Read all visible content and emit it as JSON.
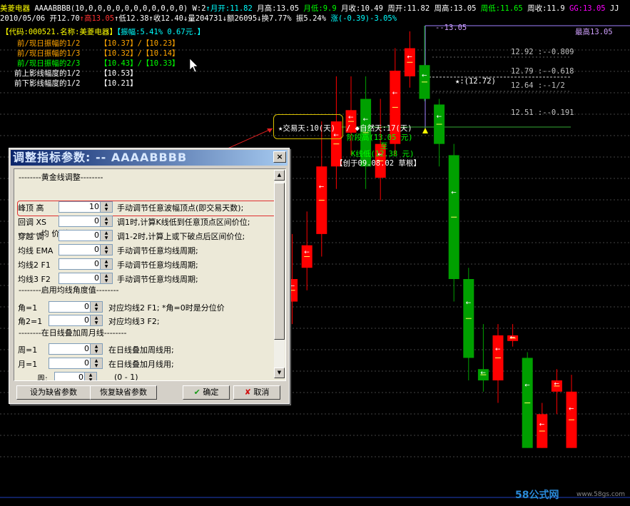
{
  "header": {
    "line1": [
      {
        "t": "美菱电器",
        "c": "#ffff00"
      },
      {
        "t": "  AAAABBBB(10,0,0,0,0,0,0,0,0,0,0,0)  W:2",
        "c": "#ffffff"
      },
      {
        "t": "↑月开:11.82",
        "c": "#00ffff"
      },
      {
        "t": "  月高:13.05",
        "c": "#ffffff"
      },
      {
        "t": "  月低:9.9",
        "c": "#00ff00"
      },
      {
        "t": "  月收:10.49",
        "c": "#ffffff"
      },
      {
        "t": "  周开:11.82",
        "c": "#ffffff"
      },
      {
        "t": "  周高:13.05",
        "c": "#ffffff"
      },
      {
        "t": "  周低:11.65",
        "c": "#00ff00"
      },
      {
        "t": "  周收:11.9",
        "c": "#ffffff"
      },
      {
        "t": "  GG:13.05",
        "c": "#ff00ff"
      },
      {
        "t": "  JJ",
        "c": "#ffffff"
      }
    ],
    "line2": [
      {
        "t": "2010/05/06",
        "c": "#ffffff"
      },
      {
        "t": "  开12.70",
        "c": "#ffffff"
      },
      {
        "t": "↑高13.05",
        "c": "#ff3030"
      },
      {
        "t": "↑低12.38",
        "c": "#ffffff"
      },
      {
        "t": "↑收12.40",
        "c": "#ffffff"
      },
      {
        "t": "↓量204731",
        "c": "#ffffff"
      },
      {
        "t": "↓额26095",
        "c": "#ffffff"
      },
      {
        "t": "↓换7.77%",
        "c": "#ffffff"
      },
      {
        "t": "  振5.24%",
        "c": "#ffffff"
      },
      {
        "t": "  涨(-0.39)-3.05%",
        "c": "#00ffff"
      }
    ],
    "line3": [
      {
        "t": "【代码:000521.名称:美菱电器】",
        "c": "#ffff00"
      },
      {
        "t": "【振幅:5.41% 0.67元.】",
        "c": "#00ffff"
      }
    ]
  },
  "info_rows": [
    {
      "label": "前/现日振幅的1/2",
      "vals": "【10.37】/【10.23】",
      "c": "#ffa500"
    },
    {
      "label": "前/现日振幅的1/3",
      "vals": "【10.32】/【10.14】",
      "c": "#ffa500"
    },
    {
      "label": "前/现日振幅的2/3",
      "vals": "【10.43】/【10.33】",
      "c": "#00ff00"
    },
    {
      "label": "前上影线幅度的1/2",
      "vals": "【10.53】",
      "c": "#ffffff"
    },
    {
      "label": "前下影线幅度的1/2",
      "vals": "【10.21】",
      "c": "#ffffff"
    }
  ],
  "levels": [
    {
      "text": "--13.05",
      "c": "#d0a0ff"
    },
    {
      "text": "最高13.05",
      "c": "#d0a0ff"
    },
    {
      "text": "12.92  :--0.809",
      "c": "#c0c0c0"
    },
    {
      "text": "12.79  :--0.618",
      "c": "#c0c0c0"
    },
    {
      "text": "12.64  :--1/2",
      "c": "#c0c0c0"
    },
    {
      "text": "12.51  :--0.191",
      "c": "#c0c0c0"
    }
  ],
  "annotations": {
    "star_value": "★:(12.72)",
    "trade_days": "★交易天:10(天)",
    "natural_days": "/ ◆自然天:17(天)",
    "stage_high": "阶段高(13.05 元)",
    "to": "至",
    "k_low": "K线低(12.38 元)",
    "created": "【创于09.08.02 草根】"
  },
  "candles": [
    {
      "o": 10.9,
      "c": 10.3,
      "h": 11.0,
      "l": 10.1,
      "col": "#ff0000"
    },
    {
      "o": 10.6,
      "c": 10.8,
      "h": 11.2,
      "l": 10.4,
      "col": "#ff0000"
    },
    {
      "o": 10.9,
      "c": 11.1,
      "h": 11.4,
      "l": 10.7,
      "col": "#ff0000"
    },
    {
      "o": 11.2,
      "c": 11.8,
      "h": 12.2,
      "l": 11.0,
      "col": "#ff0000"
    },
    {
      "o": 11.8,
      "c": 12.2,
      "h": 12.6,
      "l": 11.6,
      "col": "#ff0000"
    },
    {
      "o": 12.1,
      "c": 12.3,
      "h": 12.6,
      "l": 11.9,
      "col": "#ff0000"
    },
    {
      "o": 12.4,
      "c": 11.8,
      "h": 12.6,
      "l": 11.6,
      "col": "#00a000"
    },
    {
      "o": 11.7,
      "c": 12.0,
      "h": 12.4,
      "l": 11.5,
      "col": "#ff0000"
    },
    {
      "o": 12.0,
      "c": 12.65,
      "h": 12.85,
      "l": 11.9,
      "col": "#ff0000"
    },
    {
      "o": 12.6,
      "c": 12.85,
      "h": 13.0,
      "l": 12.5,
      "col": "#ff0000"
    },
    {
      "o": 12.7,
      "c": 12.4,
      "h": 13.05,
      "l": 12.38,
      "col": "#00a000"
    },
    {
      "o": 12.35,
      "c": 12.0,
      "h": 12.4,
      "l": 11.8,
      "col": "#00a000"
    },
    {
      "o": 11.9,
      "c": 10.8,
      "h": 12.0,
      "l": 10.6,
      "col": "#00a000"
    },
    {
      "o": 10.8,
      "c": 10.1,
      "h": 10.9,
      "l": 9.9,
      "col": "#00a000"
    },
    {
      "o": 10.0,
      "c": 9.9,
      "h": 10.4,
      "l": 9.8,
      "col": "#00a000"
    },
    {
      "o": 9.9,
      "c": 10.3,
      "h": 10.4,
      "l": 9.7,
      "col": "#ff0000"
    },
    {
      "o": 10.25,
      "c": 10.3,
      "h": 10.4,
      "l": 10.2,
      "col": "#ff0000"
    },
    {
      "o": 10.1,
      "c": 9.3,
      "h": 10.15,
      "l": 9.3,
      "col": "#00a000"
    },
    {
      "o": 9.3,
      "c": 9.6,
      "h": 9.7,
      "l": 9.3,
      "col": "#ff0000"
    },
    {
      "o": 9.8,
      "c": 9.9,
      "h": 10.0,
      "l": 9.6,
      "col": "#ff0000"
    },
    {
      "o": 9.8,
      "c": 9.3,
      "h": 9.95,
      "l": 9.3,
      "col": "#ff0000"
    }
  ],
  "dialog": {
    "title": "调整指标参数: -- AAAABBBB",
    "close": "×",
    "sections": {
      "golden": "--------黄金线调整--------",
      "ma": "--------均   价   线--------",
      "angle": "--------启用均线角度值--------",
      "wm": "--------在日线叠加周月线--------"
    },
    "params": [
      {
        "label": "峰顶 高",
        "value": "10",
        "desc": "手动调节任意波幅顶点(即交易天数);"
      },
      {
        "label": "回调 XS",
        "value": "0",
        "desc": "调1时,计算K线低到任意顶点区间价位;"
      },
      {
        "label": "穿越 调",
        "value": "0",
        "desc": "调1-2时,计算上或下破点后区间价位;"
      },
      {
        "label": "均线 EMA",
        "value": "0",
        "desc": "手动调节任意均线周期;"
      },
      {
        "label": "均线2 F1",
        "value": "0",
        "desc": "手动调节任意均线周期;"
      },
      {
        "label": "均线3 F2",
        "value": "0",
        "desc": "手动调节任意均线周期;"
      },
      {
        "label": "角=1",
        "value": "0",
        "desc": "对应均线2  F1;   *角=0时是分位价"
      },
      {
        "label": "角2=1",
        "value": "0",
        "desc": "对应均线3  F2;"
      },
      {
        "label": "周=1",
        "value": "0",
        "desc": "在日线叠加周线用;"
      },
      {
        "label": "月=1",
        "value": "0",
        "desc": "在日线叠加月线用;"
      },
      {
        "label": "周:",
        "value": "0",
        "desc": "(0 - 1)"
      }
    ],
    "buttons": {
      "set_default": "设为缺省参数",
      "restore_default": "恢复缺省参数",
      "ok": "确定",
      "cancel": "取消"
    }
  },
  "watermark": {
    "a": "58公式网",
    "b": "www.58gs.com"
  }
}
